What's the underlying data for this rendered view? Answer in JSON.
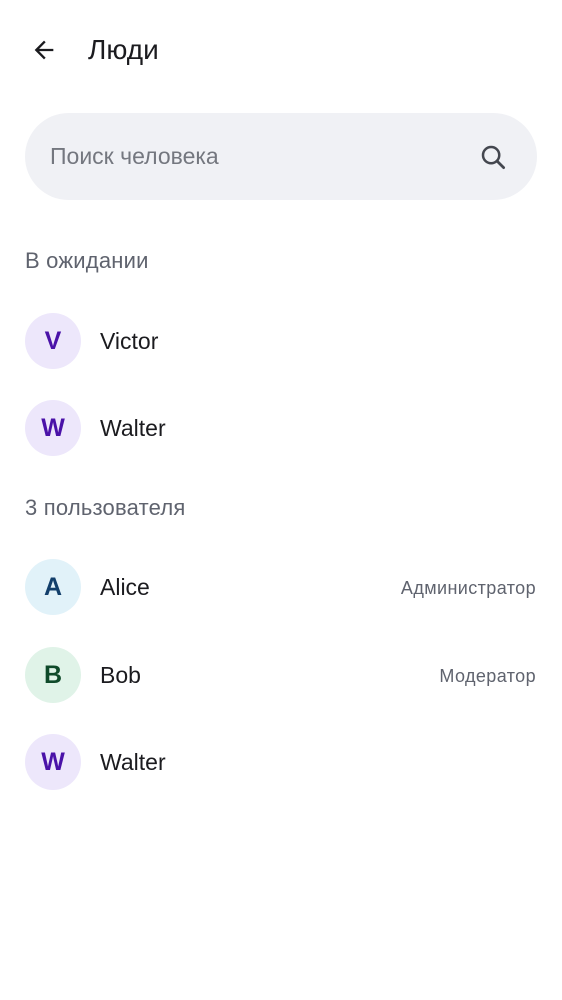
{
  "header": {
    "back_icon": "arrow-back-icon",
    "title": "Люди"
  },
  "search": {
    "placeholder": "Поиск человека",
    "value": "",
    "icon": "search-icon"
  },
  "pending": {
    "header": "В ожидании",
    "members": [
      {
        "initial": "V",
        "name": "Victor",
        "role": "",
        "avatar_bg": "#ede7fb",
        "avatar_fg": "#4a12a8"
      },
      {
        "initial": "W",
        "name": "Walter",
        "role": "",
        "avatar_bg": "#ede7fb",
        "avatar_fg": "#4a12a8"
      }
    ]
  },
  "joined": {
    "header": "3 пользователя",
    "members": [
      {
        "initial": "A",
        "name": "Alice",
        "role": "Администратор",
        "avatar_bg": "#e1f2f9",
        "avatar_fg": "#123f6b"
      },
      {
        "initial": "B",
        "name": "Bob",
        "role": "Модератор",
        "avatar_bg": "#e0f3e8",
        "avatar_fg": "#0f4a2a"
      },
      {
        "initial": "W",
        "name": "Walter",
        "role": "",
        "avatar_bg": "#ede7fb",
        "avatar_fg": "#4a12a8"
      }
    ]
  }
}
